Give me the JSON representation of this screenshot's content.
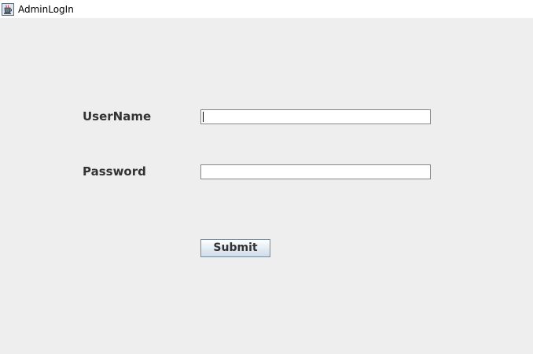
{
  "window": {
    "title": "AdminLogIn",
    "icon": "java-coffee-cup-icon"
  },
  "form": {
    "username_label": "UserName",
    "username_value": "",
    "password_label": "Password",
    "password_value": "",
    "submit_label": "Submit"
  },
  "colors": {
    "background": "#eeeeee",
    "label_text": "#333333",
    "field_border": "#7a8a99"
  }
}
